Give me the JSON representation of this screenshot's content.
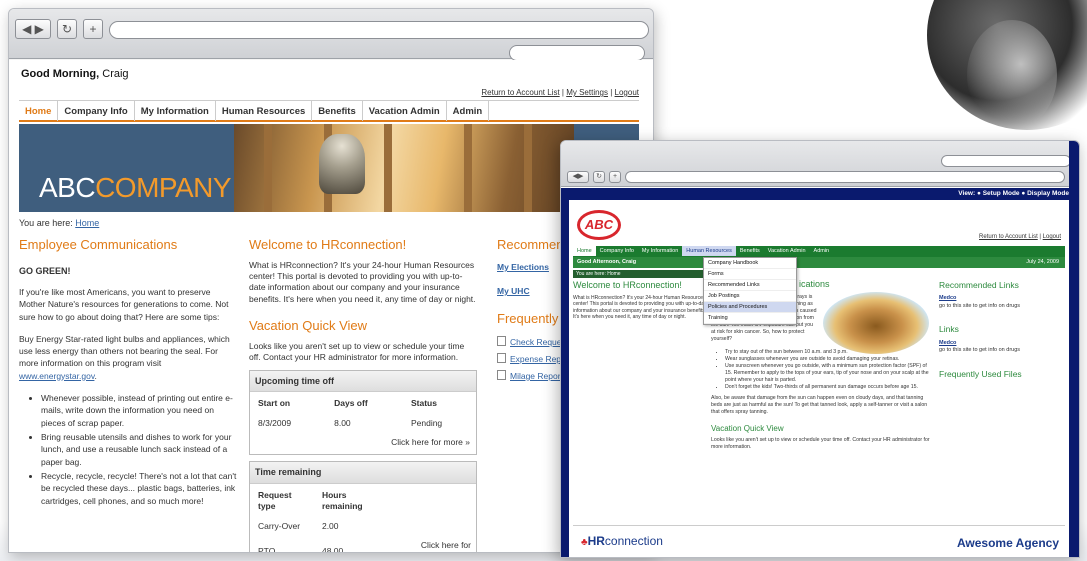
{
  "left_site": {
    "greeting_prefix": "Good Morning,",
    "greeting_name": "Craig",
    "top_links": [
      "Return to Account List",
      "My Settings",
      "Logout"
    ],
    "menu": [
      "Home",
      "Company Info",
      "My Information",
      "Human Resources",
      "Benefits",
      "Vacation Admin",
      "Admin"
    ],
    "logo_part1": "ABC",
    "logo_part2": "COMPANY",
    "breadcrumb_prefix": "You are here:",
    "breadcrumb_link": "Home",
    "communications": {
      "heading": "Employee Communications",
      "subheading": "GO GREEN!",
      "p1": "If you're like most Americans, you want to preserve Mother Nature's resources for generations to come. Not sure how to go about doing that? Here are some tips:",
      "p2": "Buy Energy Star-rated light bulbs and appliances, which use less energy than others not bearing the seal. For more information on this program visit",
      "p2_link": "www.energystar.gov",
      "bullets": [
        "Whenever possible, instead of printing out entire e-mails, write down the information you need on pieces of scrap paper.",
        "Bring reusable utensils and dishes to work for your lunch, and use a reusable lunch sack instead of a paper bag.",
        "Recycle, recycle, recycle! There's not a lot that can't be recycled these days... plastic bags, batteries, ink cartridges, cell phones, and so much more!"
      ]
    },
    "welcome": {
      "heading": "Welcome to HRconnection!",
      "text": "What is HRconnection? It's your 24-hour Human Resources center! This portal is devoted to providing you with up-to-date information about our company and your insurance benefits. It's here when you need it, any time of day or night."
    },
    "vacation": {
      "heading": "Vacation Quick View",
      "text": "Looks like you aren't set up to view or schedule your time off. Contact your HR administrator for more information.",
      "upcoming_title": "Upcoming time off",
      "upcoming_cols": [
        "Start on",
        "Days off",
        "Status"
      ],
      "upcoming_row": [
        "8/3/2009",
        "8.00",
        "Pending"
      ],
      "more_label": "Click here for more »",
      "remaining_title": "Time remaining",
      "remaining_cols": [
        "Request type",
        "Hours remaining"
      ],
      "remaining_rows": [
        [
          "Carry-Over",
          "2.00"
        ],
        [
          "PTO",
          "48.00"
        ]
      ]
    },
    "recommended": {
      "heading": "Recommende",
      "links": [
        "My Elections",
        "My UHC"
      ]
    },
    "frequent": {
      "heading": "Frequently U",
      "files": [
        "Check Reques",
        "Expense Repo",
        "Milage Report"
      ]
    }
  },
  "right_site": {
    "view_label": "View:",
    "view_modes": [
      "Setup Mode",
      "Display Mode"
    ],
    "logo": "ABC",
    "top_links": [
      "Return to Account List",
      "Logout"
    ],
    "menu": [
      "Home",
      "Company Info",
      "My Information",
      "Human Resources",
      "Benefits",
      "Vacation Admin",
      "Admin"
    ],
    "greeting": "Good Afternoon, Craig",
    "date": "July 24, 2009",
    "dropdown": [
      "Company Handbook",
      "Forms",
      "Recommended Links",
      "Job Postings",
      "Policies and Procedures",
      "Training"
    ],
    "breadcrumb": "You are here: Home",
    "welcome_heading": "Welcome to HRconnection!",
    "welcome_text": "What is HRconnection? It's your 24-hour Human Resources center! This portal is devoted to providing you with up-to-date information about our company and your insurance benefits. It's here when you need it, any time of day or night.",
    "comm_heading": "ications",
    "comm_p1": "While a little vitamin D from the sun's rays is good for you, there is really no such thing as a \"healthy glow.\" Any type of suntan is caused by exposure to ultraviolet (UV) radiation from the sun. Too much UV exposure can put you at risk for skin cancer. So, how to protect yourself?",
    "comm_bullets": [
      "Try to stay out of the sun between 10 a.m. and 3 p.m.",
      "Wear sunglasses whenever you are outside to avoid damaging your retinas.",
      "Use sunscreen whenever you go outside, with a minimum sun protection factor (SPF) of 15. Remember to apply to the tops of your ears, tip of your nose and on your scalp at the point where your hair is parted.",
      "Don't forget the kids! Two-thirds of all permanent sun damage occurs before age 15."
    ],
    "comm_p2": "Also, be aware that damage from the sun can happen even on cloudy days, and that tanning beds are just as harmful as the sun! To get that tanned look, apply a self-tanner or visit a salon that offers spray tanning.",
    "vacation_heading": "Vacation Quick View",
    "vacation_text": "Looks like you aren't set up to view or schedule your time off. Contact your HR administrator for more information.",
    "recommended_heading": "Recommended Links",
    "recommended_link": "Medco",
    "recommended_text": "go to this site to get info on drugs",
    "links_heading": "Links",
    "links_link": "Medco",
    "links_text": "go to this site to get info on drugs",
    "files_heading": "Frequently Used Files",
    "footer_logo_a": "HR",
    "footer_logo_b": "connection",
    "agency": "Awesome Agency"
  }
}
